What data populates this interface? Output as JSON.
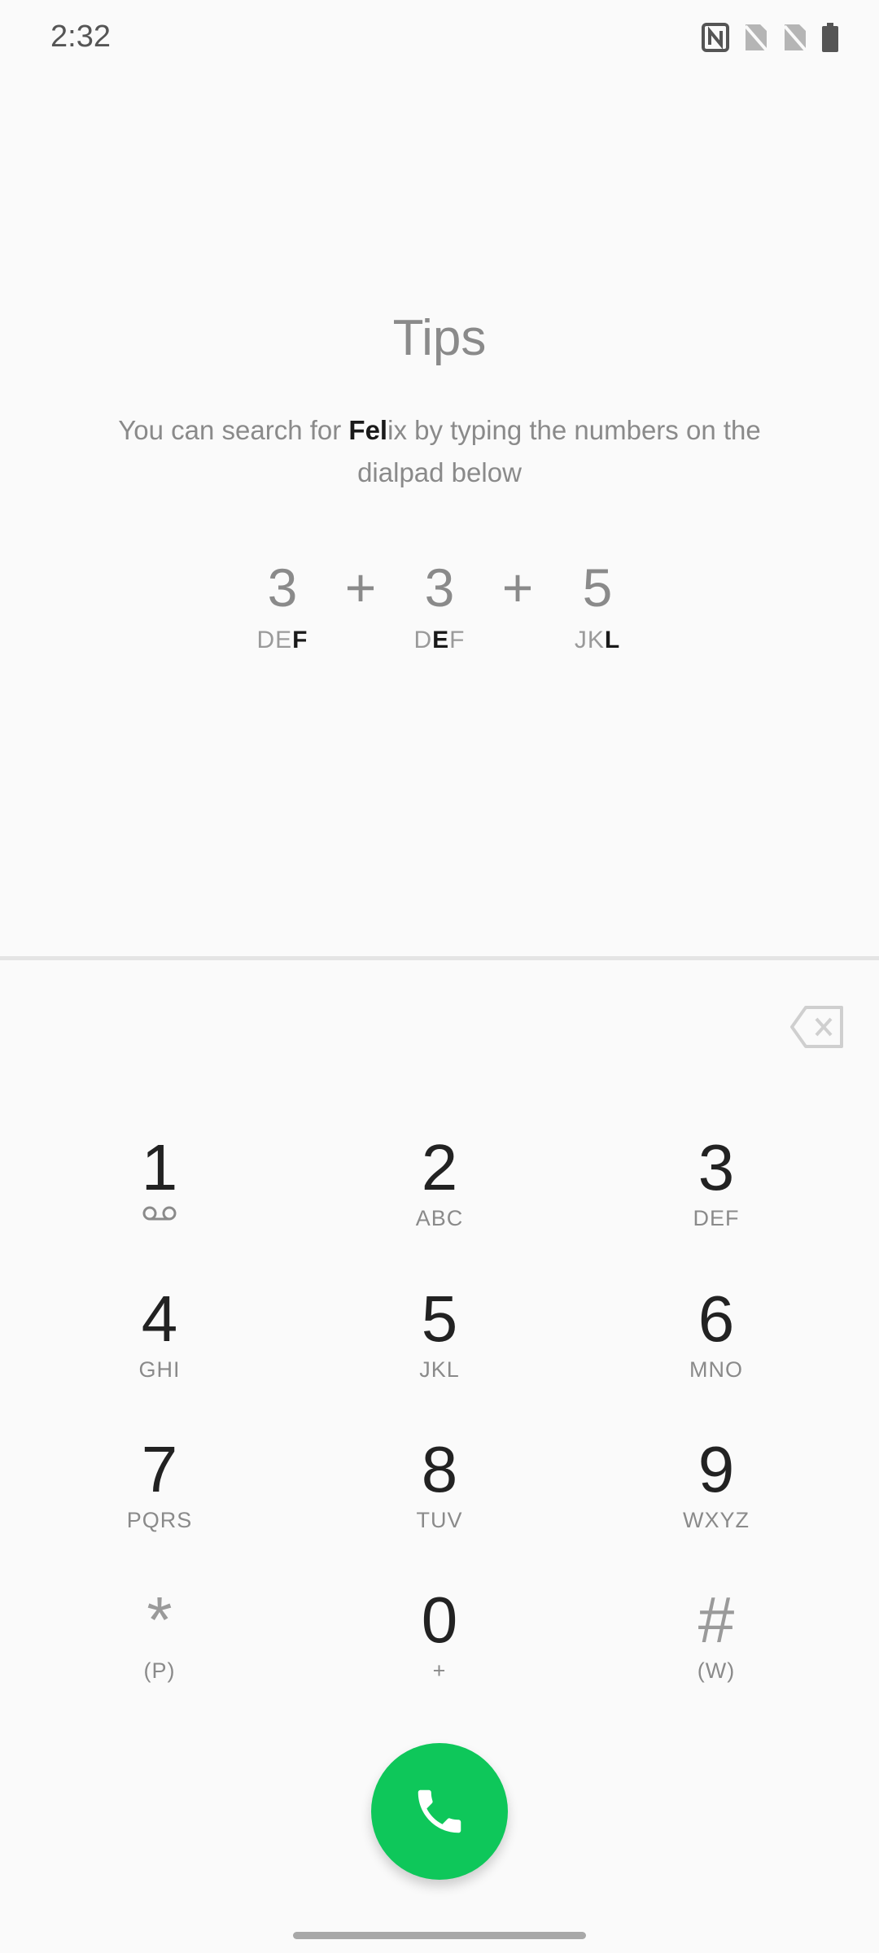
{
  "status_bar": {
    "time": "2:32",
    "icons": [
      "nfc-icon",
      "sim-off-icon",
      "sim-off-icon",
      "battery-icon"
    ]
  },
  "tips": {
    "title": "Tips",
    "desc_prefix": "You can search for ",
    "desc_bold": "Fel",
    "desc_suffix": "ix by typing the numbers on the dialpad below",
    "combo": [
      {
        "digit": "3",
        "letters_plain": "DE",
        "letters_bold": "F",
        "letters_after": ""
      },
      {
        "digit": "3",
        "letters_plain": "D",
        "letters_bold": "E",
        "letters_after": "F"
      },
      {
        "digit": "5",
        "letters_plain": "JK",
        "letters_bold": "L",
        "letters_after": ""
      }
    ],
    "plus": "+"
  },
  "keypad": {
    "keys": [
      {
        "digit": "1",
        "letters": ""
      },
      {
        "digit": "2",
        "letters": "ABC"
      },
      {
        "digit": "3",
        "letters": "DEF"
      },
      {
        "digit": "4",
        "letters": "GHI"
      },
      {
        "digit": "5",
        "letters": "JKL"
      },
      {
        "digit": "6",
        "letters": "MNO"
      },
      {
        "digit": "7",
        "letters": "PQRS"
      },
      {
        "digit": "8",
        "letters": "TUV"
      },
      {
        "digit": "9",
        "letters": "WXYZ"
      },
      {
        "digit": "*",
        "letters": "(P)"
      },
      {
        "digit": "0",
        "letters": "+"
      },
      {
        "digit": "#",
        "letters": "(W)"
      }
    ]
  },
  "colors": {
    "call_button": "#0ec75a",
    "background": "#fafafa"
  }
}
